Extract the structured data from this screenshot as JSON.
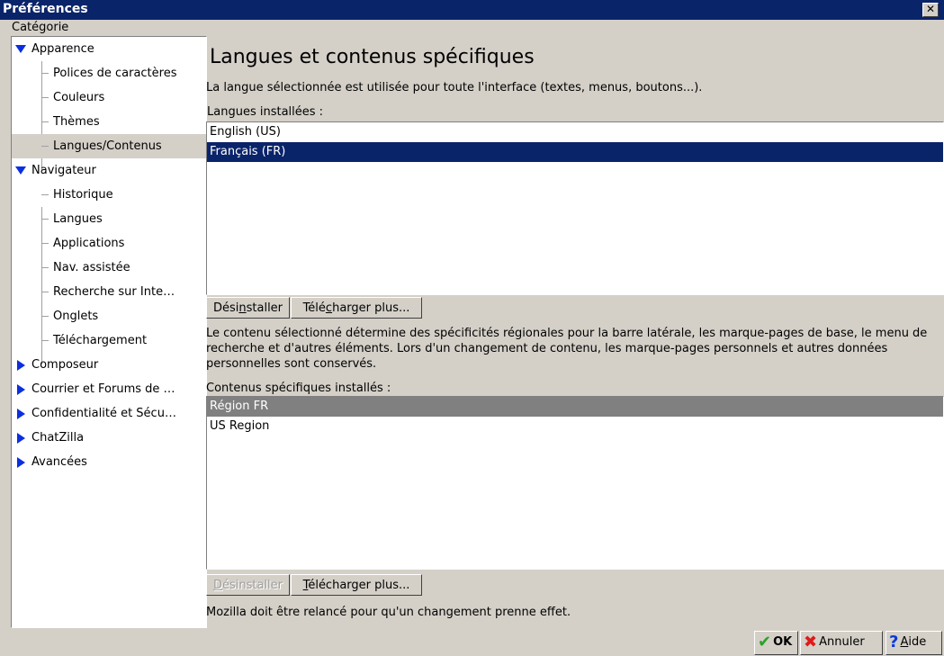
{
  "window": {
    "title": "Préférences",
    "close_symbol": "✕"
  },
  "sidebar": {
    "heading": "Catégorie",
    "groups": [
      {
        "label": "Apparence",
        "expanded": true,
        "items": [
          "Polices de caractères",
          "Couleurs",
          "Thèmes",
          "Langues/Contenus"
        ]
      },
      {
        "label": "Navigateur",
        "expanded": true,
        "items": [
          "Historique",
          "Langues",
          "Applications",
          "Nav. assistée",
          "Recherche sur Inte…",
          "Onglets",
          "Téléchargement"
        ]
      },
      {
        "label": "Composeur",
        "expanded": false,
        "items": []
      },
      {
        "label": "Courrier et Forums de …",
        "expanded": false,
        "items": []
      },
      {
        "label": "Confidentialité et Sécu…",
        "expanded": false,
        "items": []
      },
      {
        "label": "ChatZilla",
        "expanded": false,
        "items": []
      },
      {
        "label": "Avancées",
        "expanded": false,
        "items": []
      }
    ],
    "selected": "Langues/Contenus"
  },
  "panel": {
    "title": "Langues et contenus spécifiques",
    "lang_description": "La langue sélectionnée est utilisée pour toute l'interface (textes, menus, boutons...).",
    "installed_languages_label": "Langues installées :",
    "languages": [
      "English (US)",
      "Français (FR)"
    ],
    "uninstall_button_pre": "Dési",
    "uninstall_button_key": "n",
    "uninstall_button_post": "staller",
    "download_button_pre": "Télé",
    "download_button_key": "c",
    "download_button_post": "harger plus...",
    "content_description": "Le contenu sélectionné détermine des spécificités régionales pour la barre latérale, les marque-pages de base, le menu de recherche et d'autres éléments. Lors d'un changement de contenu, les marque-pages personnels et autres données personnelles sont conservés.",
    "installed_contents_label": "Contenus spécifiques installés :",
    "contents": [
      "Région FR",
      "US Region"
    ],
    "uninstall2_key": "D",
    "uninstall2_post": "ésinstaller",
    "download2_key": "T",
    "download2_post": "élécharger plus...",
    "restart_note": "Mozilla doit être relancé pour qu'un changement prenne effet."
  },
  "footer": {
    "ok_label": "OK",
    "cancel_label": "Annuler",
    "help_key": "A",
    "help_post": "ide"
  },
  "colors": {
    "titlebar": "#0a246a",
    "selection": "#0a246a",
    "dialog": "#d4d0c8",
    "tree_arrow": "#0a2fe0"
  },
  "icons": {
    "ok": "check-icon",
    "cancel": "x-icon",
    "help": "question-icon"
  }
}
